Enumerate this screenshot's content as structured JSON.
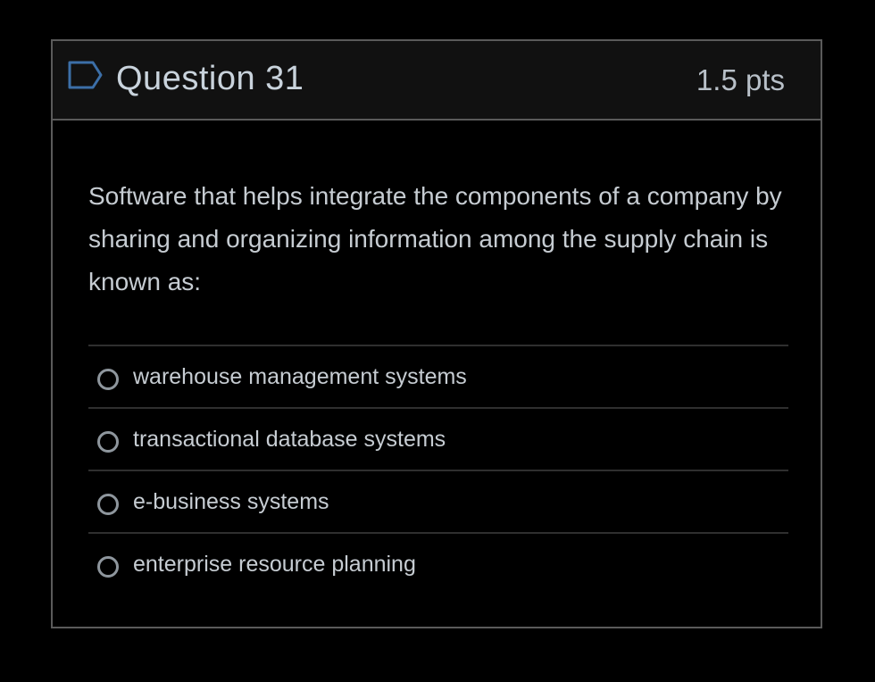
{
  "question": {
    "title": "Question 31",
    "points": "1.5 pts",
    "text": "Software that helps integrate the components of a company by sharing and organizing information among the supply chain is known as:",
    "flag_icon": "flag-outline-icon"
  },
  "answers": [
    {
      "label": "warehouse management systems",
      "selected": false
    },
    {
      "label": "transactional database systems",
      "selected": false
    },
    {
      "label": "e-business systems",
      "selected": false
    },
    {
      "label": "enterprise resource planning",
      "selected": false
    }
  ],
  "colors": {
    "background": "#000000",
    "header_bg": "#111111",
    "flag": "#3c6fa8",
    "title_text": "#c9d3dc",
    "body_text": "#c6ccd2"
  }
}
